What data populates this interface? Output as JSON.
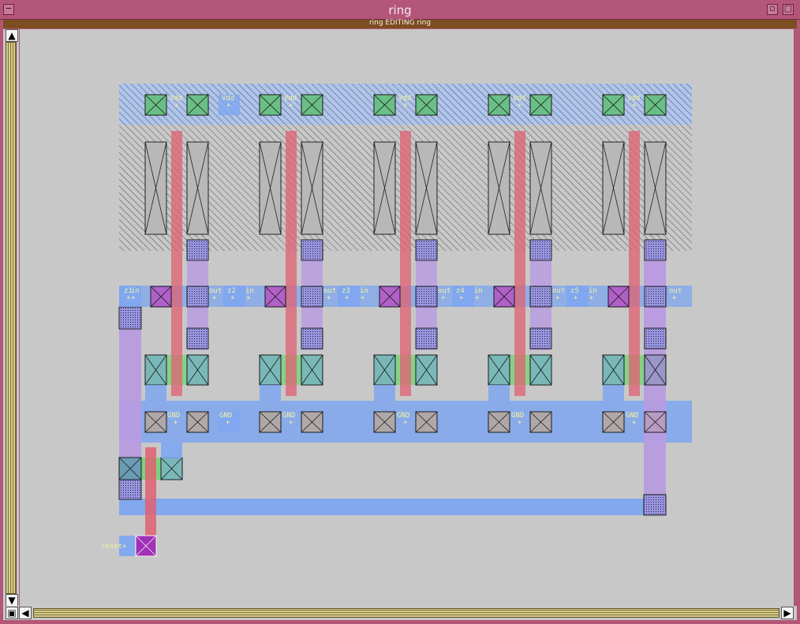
{
  "window": {
    "title": "ring",
    "subtitle": "ring EDITING ring",
    "menu_button_glyph": "−",
    "controls": {
      "restore_glyph": "▫",
      "maximize_glyph": "□"
    }
  },
  "scrollbars": {
    "vertical": {
      "up_glyph": "▲",
      "down_glyph": "▼"
    },
    "horizontal": {
      "left_glyph": "◀",
      "right_glyph": "▶",
      "corner_glyph": "▣"
    }
  },
  "layout_labels": {
    "vdd": "Vdd",
    "gnd": "GND",
    "in": "in",
    "out": "out",
    "z1": "z1",
    "z2": "z2",
    "z3": "z3",
    "z4": "z4",
    "z5": "z5",
    "reset": "reset",
    "plus": "+"
  },
  "colors": {
    "window_frame": "#b35677",
    "subbar": "#7b4d20",
    "canvas_bg": "#c8c8c8",
    "metal1": "#7ea6f0",
    "metal2": "#b89ce0",
    "poly": "#e06070",
    "diffusion": "#6cd46c",
    "contact_pdiff": "#6abf86",
    "contact_ndiff": "#7ab8b8",
    "contact_poly": "#b060c8",
    "via": "#9890d8",
    "label_text": "#f2f2a0"
  }
}
